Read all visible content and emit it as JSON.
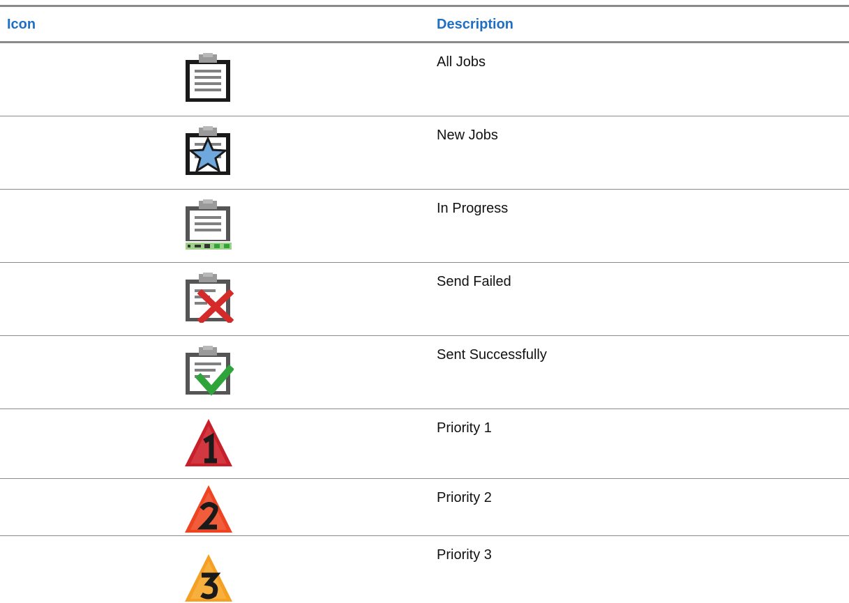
{
  "table": {
    "headers": {
      "icon": "Icon",
      "description": "Description"
    },
    "rows": [
      {
        "icon": "all-jobs-icon",
        "description": "All Jobs"
      },
      {
        "icon": "new-jobs-icon",
        "description": "New Jobs"
      },
      {
        "icon": "in-progress-icon",
        "description": "In Progress"
      },
      {
        "icon": "send-failed-icon",
        "description": "Send Failed"
      },
      {
        "icon": "sent-successfully-icon",
        "description": "Sent Successfully"
      },
      {
        "icon": "priority-1-icon",
        "description": "Priority 1"
      },
      {
        "icon": "priority-2-icon",
        "description": "Priority 2"
      },
      {
        "icon": "priority-3-icon",
        "description": "Priority 3"
      }
    ]
  },
  "colors": {
    "header_text": "#1f6fc5",
    "rule": "#8a8a8a",
    "priority_1": "#c8202a",
    "priority_2": "#ee4422",
    "priority_3": "#f6a023",
    "success": "#2ea43a",
    "failed": "#d42a2a",
    "new_star": "#6fa8dc"
  }
}
